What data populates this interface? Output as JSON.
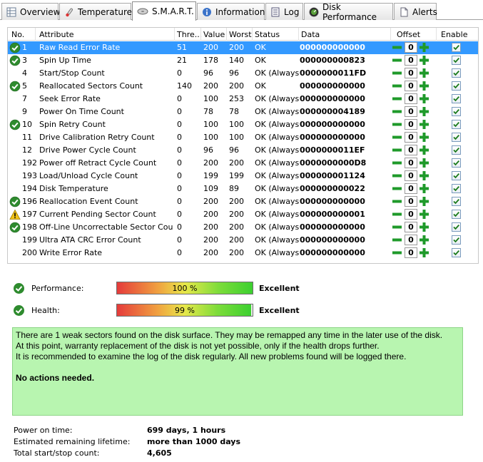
{
  "tabs": [
    {
      "label": "Overview",
      "icon": "grid-icon",
      "active": false
    },
    {
      "label": "Temperature",
      "icon": "thermometer-icon",
      "active": false
    },
    {
      "label": "S.M.A.R.T.",
      "icon": "disk-icon",
      "active": true
    },
    {
      "label": "Information",
      "icon": "info-icon",
      "active": false
    },
    {
      "label": "Log",
      "icon": "log-icon",
      "active": false
    },
    {
      "label": "Disk Performance",
      "icon": "gauge-icon",
      "active": false
    },
    {
      "label": "Alerts",
      "icon": "document-icon",
      "active": false
    }
  ],
  "table": {
    "columns": {
      "no": "No.",
      "attribute": "Attribute",
      "threshold": "Thre...",
      "value": "Value",
      "worst": "Worst",
      "status": "Status",
      "data": "Data",
      "offset": "Offset",
      "enable": "Enable"
    },
    "rows": [
      {
        "no": "1",
        "attribute": "Raw Read Error Rate",
        "threshold": "51",
        "value": "200",
        "worst": "200",
        "status": "OK",
        "data": "000000000000",
        "offset": "0",
        "enabled": true,
        "icon": "ok-icon",
        "selected": true
      },
      {
        "no": "3",
        "attribute": "Spin Up Time",
        "threshold": "21",
        "value": "178",
        "worst": "140",
        "status": "OK",
        "data": "000000000823",
        "offset": "0",
        "enabled": true,
        "icon": "ok-icon",
        "selected": false
      },
      {
        "no": "4",
        "attribute": "Start/Stop Count",
        "threshold": "0",
        "value": "96",
        "worst": "96",
        "status": "OK (Always...",
        "data": "0000000011FD",
        "offset": "0",
        "enabled": true,
        "icon": "",
        "selected": false
      },
      {
        "no": "5",
        "attribute": "Reallocated Sectors Count",
        "threshold": "140",
        "value": "200",
        "worst": "200",
        "status": "OK",
        "data": "000000000000",
        "offset": "0",
        "enabled": true,
        "icon": "ok-icon",
        "selected": false
      },
      {
        "no": "7",
        "attribute": "Seek Error Rate",
        "threshold": "0",
        "value": "100",
        "worst": "253",
        "status": "OK (Always...",
        "data": "000000000000",
        "offset": "0",
        "enabled": true,
        "icon": "",
        "selected": false
      },
      {
        "no": "9",
        "attribute": "Power On Time Count",
        "threshold": "0",
        "value": "78",
        "worst": "78",
        "status": "OK (Always...",
        "data": "000000004189",
        "offset": "0",
        "enabled": true,
        "icon": "",
        "selected": false
      },
      {
        "no": "10",
        "attribute": "Spin Retry Count",
        "threshold": "0",
        "value": "100",
        "worst": "100",
        "status": "OK (Always...",
        "data": "000000000000",
        "offset": "0",
        "enabled": true,
        "icon": "ok-icon",
        "selected": false
      },
      {
        "no": "11",
        "attribute": "Drive Calibration Retry Count",
        "threshold": "0",
        "value": "100",
        "worst": "100",
        "status": "OK (Always...",
        "data": "000000000000",
        "offset": "0",
        "enabled": true,
        "icon": "",
        "selected": false
      },
      {
        "no": "12",
        "attribute": "Drive Power Cycle Count",
        "threshold": "0",
        "value": "96",
        "worst": "96",
        "status": "OK (Always...",
        "data": "0000000011EF",
        "offset": "0",
        "enabled": true,
        "icon": "",
        "selected": false
      },
      {
        "no": "192",
        "attribute": "Power off Retract Cycle Count",
        "threshold": "0",
        "value": "200",
        "worst": "200",
        "status": "OK (Always...",
        "data": "0000000000D8",
        "offset": "0",
        "enabled": true,
        "icon": "",
        "selected": false
      },
      {
        "no": "193",
        "attribute": "Load/Unload Cycle Count",
        "threshold": "0",
        "value": "199",
        "worst": "199",
        "status": "OK (Always...",
        "data": "000000001124",
        "offset": "0",
        "enabled": true,
        "icon": "",
        "selected": false
      },
      {
        "no": "194",
        "attribute": "Disk Temperature",
        "threshold": "0",
        "value": "109",
        "worst": "89",
        "status": "OK (Always...",
        "data": "000000000022",
        "offset": "0",
        "enabled": true,
        "icon": "",
        "selected": false
      },
      {
        "no": "196",
        "attribute": "Reallocation Event Count",
        "threshold": "0",
        "value": "200",
        "worst": "200",
        "status": "OK (Always...",
        "data": "000000000000",
        "offset": "0",
        "enabled": true,
        "icon": "ok-icon",
        "selected": false
      },
      {
        "no": "197",
        "attribute": "Current Pending Sector Count",
        "threshold": "0",
        "value": "200",
        "worst": "200",
        "status": "OK (Always...",
        "data": "000000000001",
        "offset": "0",
        "enabled": true,
        "icon": "warning-icon",
        "selected": false
      },
      {
        "no": "198",
        "attribute": "Off-Line Uncorrectable Sector Count",
        "threshold": "0",
        "value": "200",
        "worst": "200",
        "status": "OK (Always...",
        "data": "000000000000",
        "offset": "0",
        "enabled": true,
        "icon": "ok-icon",
        "selected": false
      },
      {
        "no": "199",
        "attribute": "Ultra ATA CRC Error Count",
        "threshold": "0",
        "value": "200",
        "worst": "200",
        "status": "OK (Always...",
        "data": "000000000000",
        "offset": "0",
        "enabled": true,
        "icon": "",
        "selected": false
      },
      {
        "no": "200",
        "attribute": "Write Error Rate",
        "threshold": "0",
        "value": "200",
        "worst": "200",
        "status": "OK (Always...",
        "data": "000000000000",
        "offset": "0",
        "enabled": true,
        "icon": "",
        "selected": false
      }
    ]
  },
  "performance": {
    "label": "Performance:",
    "percent_text": "100 %",
    "level": 1.0,
    "verdict": "Excellent"
  },
  "health": {
    "label": "Health:",
    "percent_text": "99 %",
    "level": 0.99,
    "verdict": "Excellent"
  },
  "message": {
    "lines": [
      "There are 1 weak sectors found on the disk surface. They may be remapped any time in the later use of the disk.",
      "At this point, warranty replacement of the disk is not yet possible, only if the health drops further.",
      "It is recommended to examine the log of the disk regularly. All new problems found will be logged there."
    ],
    "action": "No actions needed."
  },
  "summary": [
    {
      "label": "Power on time:",
      "value": "699 days, 1 hours"
    },
    {
      "label": "Estimated remaining lifetime:",
      "value": "more than 1000 days"
    },
    {
      "label": "Total start/stop count:",
      "value": "4,605"
    }
  ],
  "colors": {
    "selection": "#3399ff",
    "message_bg": "#b8f5b0",
    "ok_green": "#2e8b2e",
    "offset_red": "#cc2222",
    "offset_green": "#1f9a2a"
  }
}
